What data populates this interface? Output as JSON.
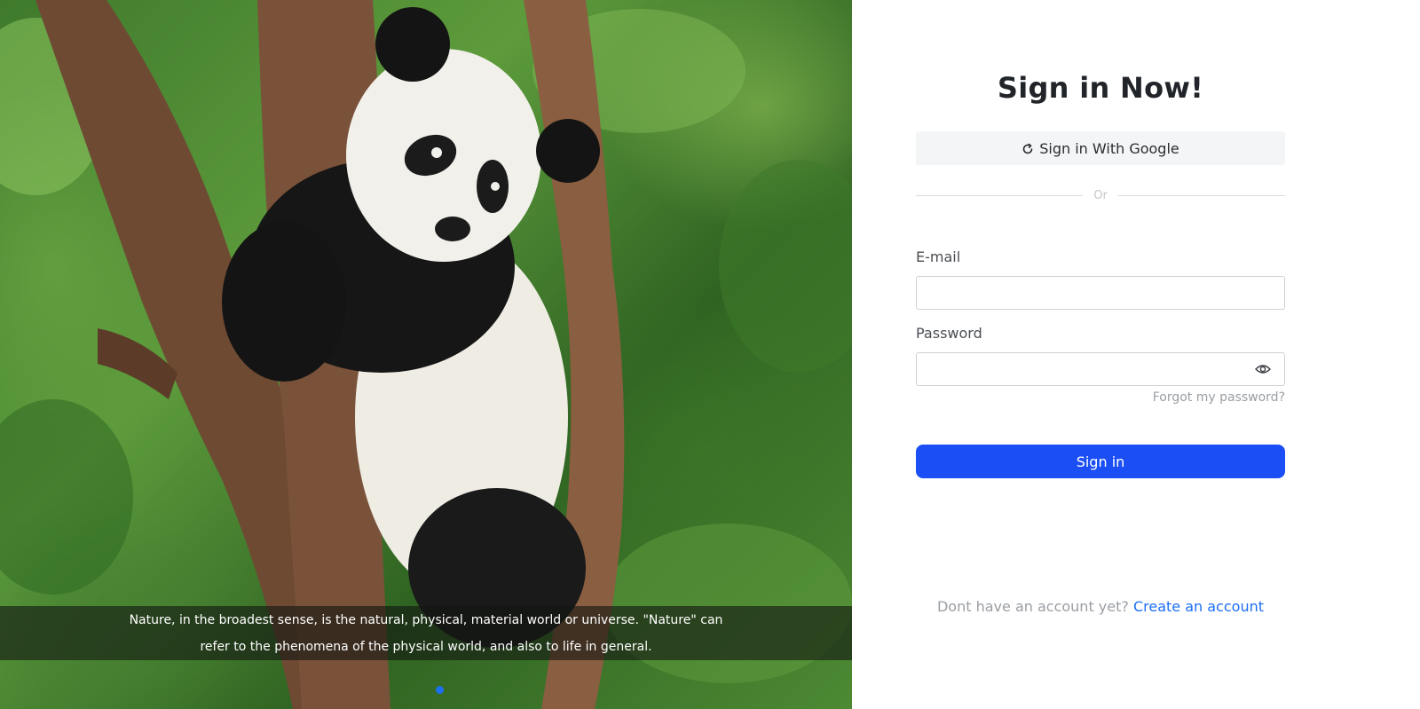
{
  "hero": {
    "caption": "Nature, in the broadest sense, is the natural, physical, material world or universe. \"Nature\" can refer to the phenomena of the physical world, and also to life in general.",
    "slides_total": 1,
    "active_slide": 1,
    "image_subject": "panda-in-tree"
  },
  "signin": {
    "title": "Sign in Now!",
    "google_button_label": "Sign in With Google",
    "google_icon": "refresh-icon",
    "divider_text": "Or",
    "email_label": "E-mail",
    "email_value": "",
    "email_placeholder": "",
    "password_label": "Password",
    "password_value": "",
    "password_placeholder": "",
    "show_password_icon": "eye-icon",
    "forgot_password": "Forgot my password?",
    "submit_label": "Sign in",
    "footer_prompt": "Dont have an account yet?",
    "create_account_link": "Create an account"
  },
  "colors": {
    "primary_button": "#1b4ff5",
    "link": "#1c6ef2",
    "carousel_dot_active": "#1d6ff2",
    "title_text": "#212529",
    "muted_text": "#9a9ea3"
  }
}
